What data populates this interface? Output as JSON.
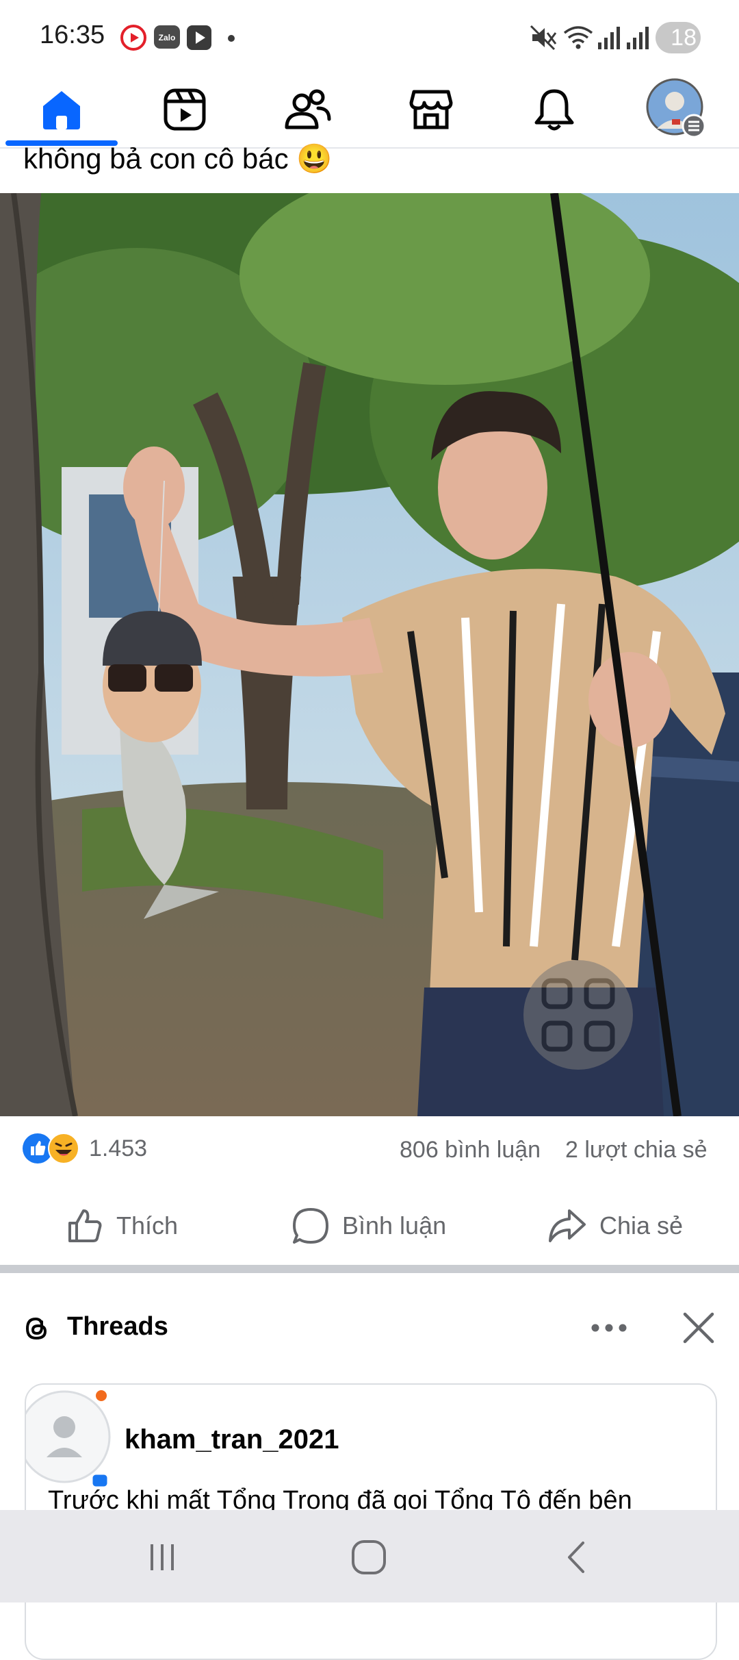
{
  "status_bar": {
    "time": "16:35",
    "notification_icons": [
      "youtube-red-icon",
      "zalo-icon",
      "play-icon",
      "dot-icon"
    ],
    "system_icons": [
      "mute-icon",
      "wifi-icon",
      "signal-icon",
      "signal-icon"
    ],
    "battery": "18"
  },
  "nav": {
    "items": [
      {
        "name": "home",
        "icon": "home-icon",
        "active": true
      },
      {
        "name": "reels",
        "icon": "video-icon",
        "active": false
      },
      {
        "name": "friends",
        "icon": "friends-icon",
        "active": false
      },
      {
        "name": "marketplace",
        "icon": "store-icon",
        "active": false
      },
      {
        "name": "notifications",
        "icon": "bell-icon",
        "active": false
      },
      {
        "name": "profile",
        "icon": "avatar-menu-icon",
        "active": false
      }
    ],
    "accent_color": "#0866ff"
  },
  "post": {
    "caption": "không bả con cô bác 😃",
    "reaction_count": "1.453",
    "reaction_icons": [
      "like-icon",
      "haha-icon"
    ],
    "comments": "806 bình luận",
    "shares": "2 lượt chia sẻ",
    "actions": {
      "like": "Thích",
      "comment": "Bình luận",
      "share": "Chia sẻ"
    }
  },
  "threads": {
    "title": "Threads",
    "card": {
      "username": "kham_tran_2021",
      "text": "Trước khi mất Tổng Trọng đã gọi Tổng Tô đến bên"
    }
  },
  "system_nav": [
    "recents-icon",
    "home-circle-icon",
    "back-icon"
  ]
}
